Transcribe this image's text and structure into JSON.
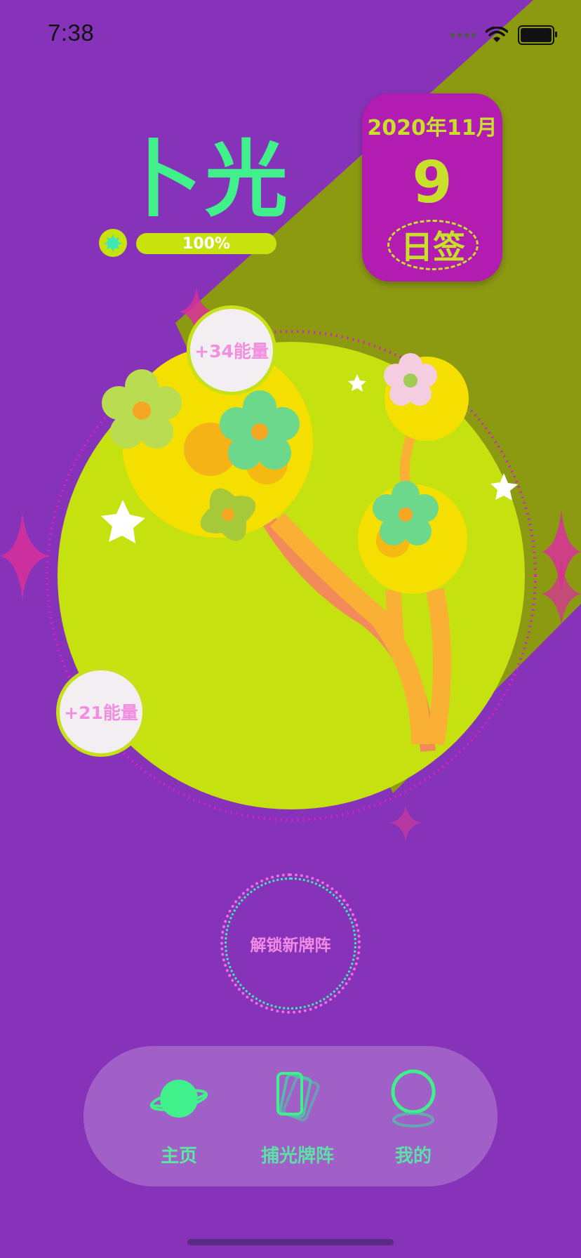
{
  "status_bar": {
    "time": "7:38"
  },
  "header": {
    "title": "卜光",
    "energy_percent_label": "100%",
    "energy_level": 1.0
  },
  "daily_card": {
    "year_month": "2020年11月",
    "day": "9",
    "sign_label": "日签"
  },
  "energy_bubbles": [
    {
      "label": "+34能量"
    },
    {
      "label": "+21能量"
    }
  ],
  "unlock": {
    "label": "解锁新牌阵"
  },
  "tabbar": {
    "items": [
      {
        "label": "主页",
        "icon": "planet-icon",
        "active": true
      },
      {
        "label": "捕光牌阵",
        "icon": "cards-icon",
        "active": false
      },
      {
        "label": "我的",
        "icon": "profile-icon",
        "active": false
      }
    ]
  },
  "colors": {
    "background": "#8733b9",
    "accent_green": "#3ff08b",
    "lime": "#c8e20d",
    "card_magenta": "#b21cb0",
    "bubble_text": "#f28ee0",
    "tab_label_active": "#5de8a0",
    "tab_label": "#5de0a8"
  }
}
